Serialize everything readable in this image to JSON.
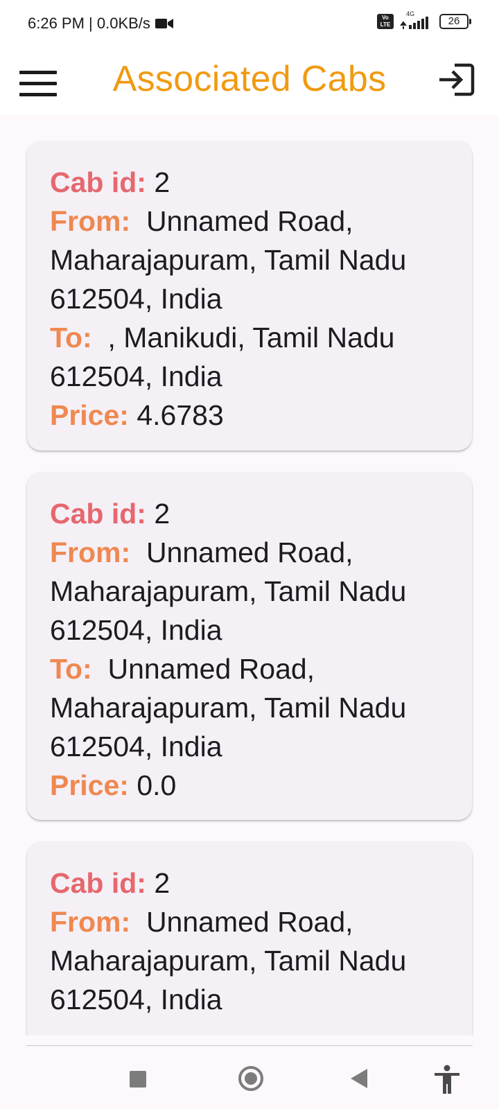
{
  "status_bar": {
    "time_speed": "6:26 PM | 0.0KB/s",
    "network": "4G",
    "volte": "Vo LTE",
    "battery": "26"
  },
  "app_bar": {
    "title": "Associated Cabs",
    "menu_icon": "hamburger-menu-icon",
    "logout_icon": "logout-icon"
  },
  "labels": {
    "cab_id": "Cab id:",
    "from": "From:",
    "to": "To:",
    "price": "Price:"
  },
  "cabs": [
    {
      "cab_id": "2",
      "from": "Unnamed Road, Maharajapuram, Tamil Nadu 612504, India",
      "to": ", Manikudi, Tamil Nadu 612504, India",
      "price": "4.6783"
    },
    {
      "cab_id": "2",
      "from": "Unnamed Road, Maharajapuram, Tamil Nadu 612504, India",
      "to": "Unnamed Road, Maharajapuram, Tamil Nadu 612504, India",
      "price": "0.0"
    },
    {
      "cab_id": "2",
      "from": "Unnamed Road, Maharajapuram, Tamil Nadu 612504, India"
    }
  ],
  "nav_bar": {
    "recent_icon": "square-recents-icon",
    "home_icon": "circle-home-icon",
    "back_icon": "triangle-back-icon",
    "accessibility_icon": "accessibility-icon"
  },
  "colors": {
    "title": "#f09a12",
    "cab_id_label": "#e6676d",
    "field_label": "#ef8850",
    "card_bg": "#f4f0f6"
  }
}
